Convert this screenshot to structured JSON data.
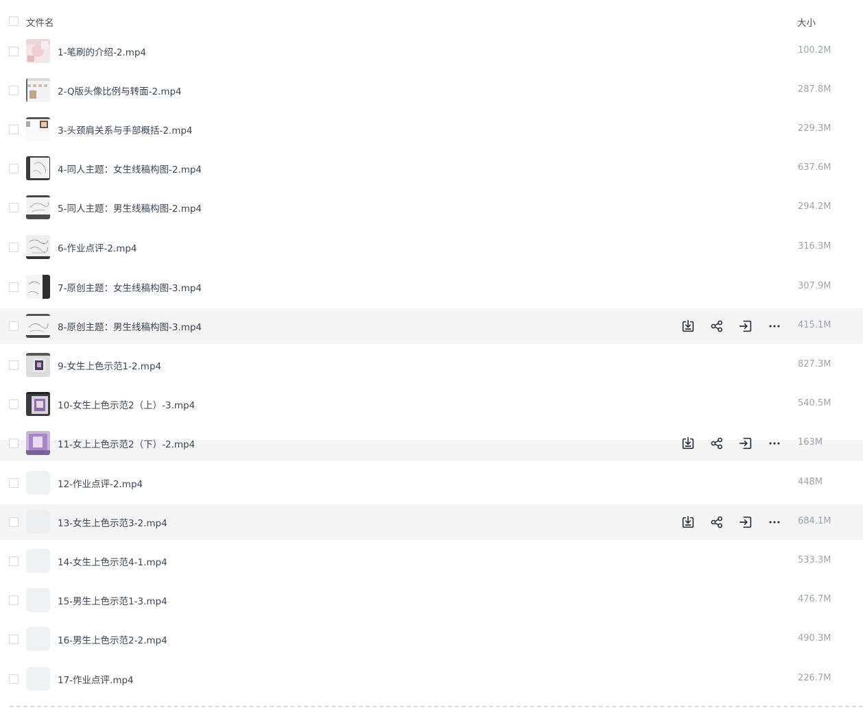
{
  "header": {
    "name_label": "文件名",
    "size_label": "大小"
  },
  "files": [
    {
      "name": "1-笔刷的介绍-2.mp4",
      "size": "100.2M"
    },
    {
      "name": "2-Q版头像比例与转面-2.mp4",
      "size": "287.8M"
    },
    {
      "name": "3-头颈肩关系与手部概括-2.mp4",
      "size": "229.3M"
    },
    {
      "name": "4-同人主题：女生线稿构图-2.mp4",
      "size": "637.6M"
    },
    {
      "name": "5-同人主题：男生线稿构图-2.mp4",
      "size": "294.2M"
    },
    {
      "name": "6-作业点评-2.mp4",
      "size": "316.3M"
    },
    {
      "name": "7-原创主题：女生线稿构图-3.mp4",
      "size": "307.9M"
    },
    {
      "name": "8-原创主题：男生线稿构图-3.mp4",
      "size": "415.1M"
    },
    {
      "name": "9-女生上色示范1-2.mp4",
      "size": "827.3M"
    },
    {
      "name": "10-女生上色示范2（上）-3.mp4",
      "size": "540.5M"
    },
    {
      "name": "11-女上上色示范2（下）-2.mp4",
      "size": "163M"
    },
    {
      "name": "12-作业点评-2.mp4",
      "size": "448M"
    },
    {
      "name": "13-女生上色示范3-2.mp4",
      "size": "684.1M"
    },
    {
      "name": "14-女生上色示范4-1.mp4",
      "size": "533.3M"
    },
    {
      "name": "15-男生上色示范1-3.mp4",
      "size": "476.7M"
    },
    {
      "name": "16-男生上色示范2-2.mp4",
      "size": "490.3M"
    },
    {
      "name": "17-作业点评.mp4",
      "size": "226.7M"
    }
  ],
  "row_actions": [
    {
      "icon": "download-icon"
    },
    {
      "icon": "share-icon"
    },
    {
      "icon": "move-to-icon"
    },
    {
      "icon": "more-icon"
    }
  ],
  "colors": {
    "hover_row": "#f5f5f6",
    "text": "#3d4552",
    "muted": "#9ea3ab",
    "icon": "#2b2f36"
  }
}
